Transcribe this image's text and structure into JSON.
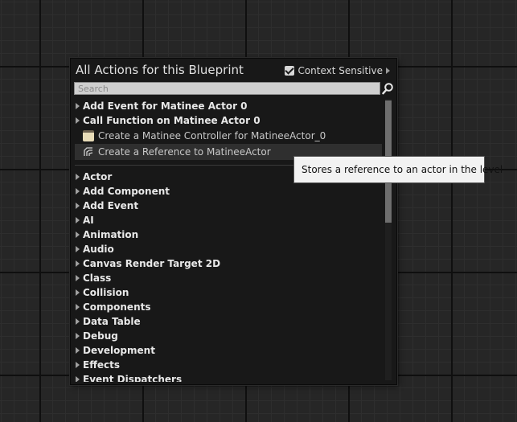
{
  "panel": {
    "title": "All Actions for this Blueprint",
    "context_sensitive": {
      "label": "Context Sensitive",
      "checked": true
    },
    "search": {
      "placeholder": "Search",
      "value": ""
    }
  },
  "actions": {
    "matinee_groups": [
      {
        "label": "Add Event for Matinee Actor 0"
      },
      {
        "label": "Call Function on Matinee Actor 0"
      }
    ],
    "matinee_leaves": [
      {
        "label": "Create a Matinee Controller for MatineeActor_0",
        "icon": "matinee-controller-icon"
      },
      {
        "label": "Create a Reference to MatineeActor",
        "icon": "actor-reference-icon",
        "selected": true
      }
    ],
    "categories": [
      {
        "label": "Actor"
      },
      {
        "label": "Add Component"
      },
      {
        "label": "Add Event"
      },
      {
        "label": "AI"
      },
      {
        "label": "Animation"
      },
      {
        "label": "Audio"
      },
      {
        "label": "Canvas Render Target 2D"
      },
      {
        "label": "Class"
      },
      {
        "label": "Collision"
      },
      {
        "label": "Components"
      },
      {
        "label": "Data Table"
      },
      {
        "label": "Debug"
      },
      {
        "label": "Development"
      },
      {
        "label": "Effects"
      },
      {
        "label": "Event Dispatchers"
      }
    ]
  },
  "tooltip": {
    "text": "Stores a reference to an actor in the level"
  },
  "colors": {
    "background": "#262626",
    "panel": "#181818",
    "tooltip": "#f2f2f2"
  }
}
